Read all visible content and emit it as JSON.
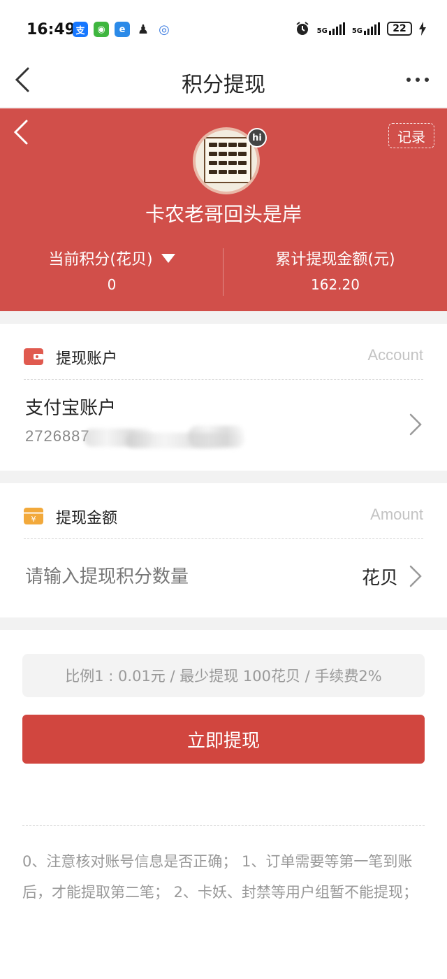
{
  "status_bar": {
    "time": "16:49",
    "apps": [
      {
        "icon": "alipay-icon",
        "glyph": "支",
        "color": "#1677ff"
      },
      {
        "icon": "wechat-icon",
        "glyph": "◉",
        "color": "#3fb63f"
      },
      {
        "icon": "browser-icon",
        "glyph": "e",
        "color": "#2b8ae8"
      },
      {
        "icon": "qq-icon",
        "glyph": "♟",
        "color": "#222222"
      },
      {
        "icon": "app-circle-icon",
        "glyph": "◎",
        "color": "#3b7be0"
      }
    ],
    "net1": "5G",
    "net2": "5G",
    "battery": "22"
  },
  "titlebar": {
    "title": "积分提现"
  },
  "hero": {
    "record": "记录",
    "hi": "hi",
    "username": "卡农老哥回头是岸",
    "points_label": "当前积分(花贝)",
    "points_value": "0",
    "total_label": "累计提现金额(元)",
    "total_value": "162.20",
    "bg_color": "#d14f4a"
  },
  "account_section": {
    "title": "提现账户",
    "title_en": "Account",
    "account_name": "支付宝账户",
    "account_number": "2726887"
  },
  "amount_section": {
    "title": "提现金额",
    "title_en": "Amount",
    "placeholder": "请输入提现积分数量",
    "unit": "花贝"
  },
  "ratio_text": "比例1 : 0.01元 / 最少提现 100花贝 / 手续费2%",
  "submit_label": "立即提现",
  "notes": "0、注意核对账号信息是否正确； 1、订单需要等第一笔到账后，才能提取第二笔； 2、卡妖、封禁等用户组暂不能提现；"
}
